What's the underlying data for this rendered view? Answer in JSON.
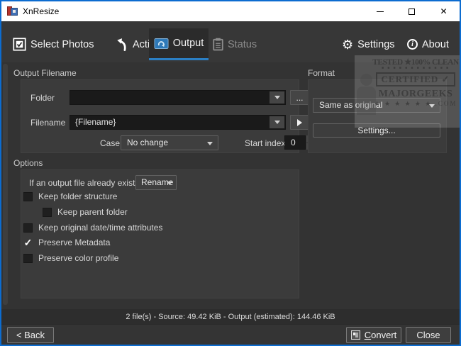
{
  "window": {
    "title": "XnResize",
    "close_glyph": "✕"
  },
  "tabs": [
    {
      "label": "Select Photos",
      "icon": "select-photos-icon",
      "active": false
    },
    {
      "label": "Action",
      "icon": "action-icon",
      "active": false
    },
    {
      "label": "Output",
      "icon": "output-icon",
      "active": true
    },
    {
      "label": "Status",
      "icon": "status-icon",
      "active": false,
      "disabled": true
    }
  ],
  "menu": {
    "settings": "Settings",
    "about": "About"
  },
  "output_filename": {
    "group_label": "Output Filename",
    "folder_label": "Folder",
    "folder_value": "",
    "browse_label": "...",
    "filename_label": "Filename",
    "filename_value": "{Filename}",
    "case_label": "Case",
    "case_value": "No change",
    "start_index_label": "Start index",
    "start_index_value": "0"
  },
  "format": {
    "group_label": "Format",
    "format_value": "Same as original",
    "settings_button": "Settings..."
  },
  "options": {
    "group_label": "Options",
    "exists_label": "If an output file already exists",
    "exists_value": "Rename",
    "checkboxes": [
      {
        "label": "Keep folder structure",
        "checked": false,
        "indent": false
      },
      {
        "label": "Keep parent folder",
        "checked": false,
        "indent": true
      },
      {
        "label": "Keep original date/time attributes",
        "checked": false,
        "indent": false
      },
      {
        "label": "Preserve Metadata",
        "checked": true,
        "indent": false
      },
      {
        "label": "Preserve color profile",
        "checked": false,
        "indent": false
      }
    ]
  },
  "status_bar": {
    "text": "2 file(s) - Source: 49.42 KiB - Output (estimated): 144.46 KiB"
  },
  "footer": {
    "back_label": "< Back",
    "convert_mnemonic": "C",
    "convert_rest": "onvert",
    "close_label": "Close"
  },
  "watermark": {
    "line1": "TESTED ★100% CLEAN",
    "dots": "■ ■ ■ ■ ■ ■ ■ ■ ■ ■ ■ ■",
    "certified": "CERTIFIED ✓",
    "brand": "MAJORGEEKS",
    "stars": "★ ★ ★ ★ ★ ★  .COM"
  },
  "icons": {
    "check": "✓",
    "gear": "⚙",
    "about_i": "i"
  },
  "colors": {
    "window_border": "#0c6cd0",
    "titlebar_bg": "#ffffff",
    "tabbar_bg": "#373737",
    "active_tab_bg": "#2b2b2b",
    "accent_blue": "#2b7fc4",
    "content_bg": "#333333",
    "panel_bg": "#3b3b3b",
    "field_bg": "#1a1a1a",
    "button_bg": "#3e3e3e",
    "text": "#e8e8e8",
    "disabled_text": "#8c8c8c"
  }
}
